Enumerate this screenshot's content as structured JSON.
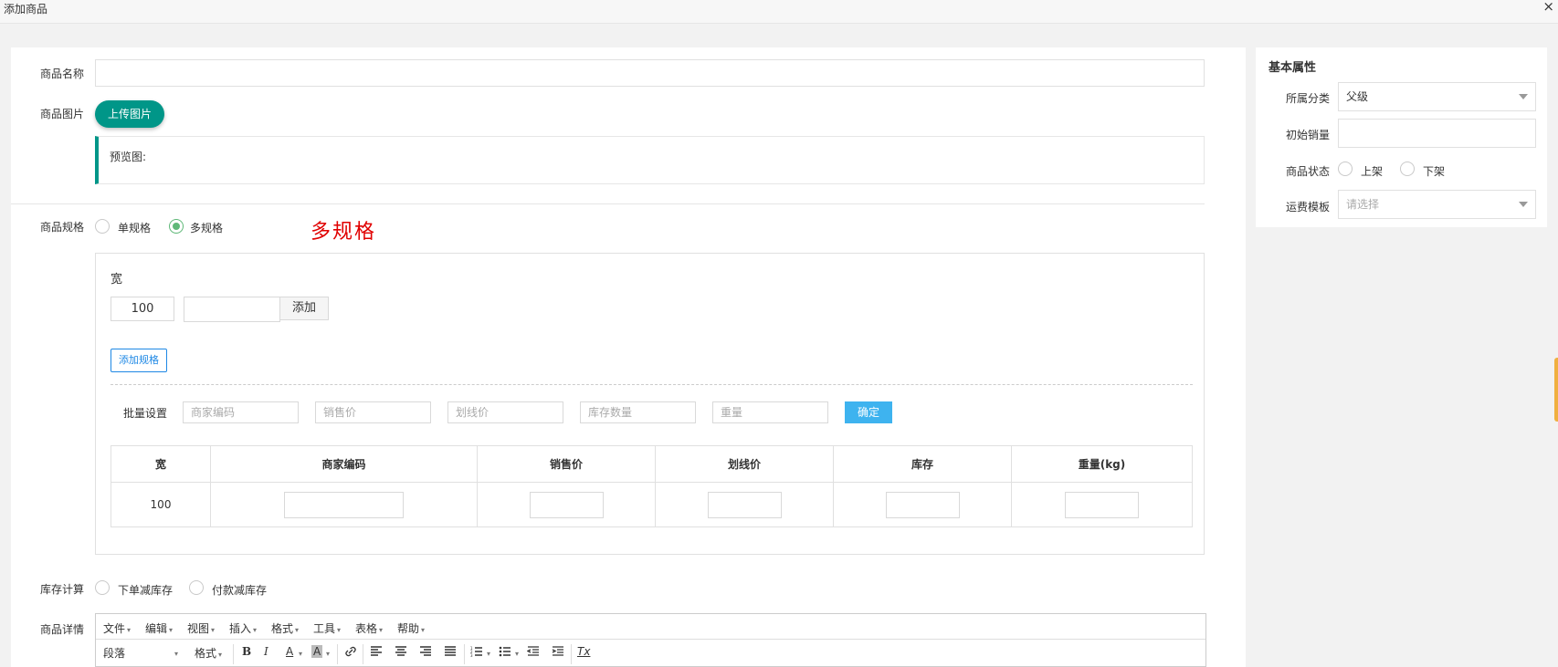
{
  "window": {
    "title": "添加商品",
    "close": "×"
  },
  "form": {
    "name_label": "商品名称",
    "image_label": "商品图片",
    "upload_button": "上传图片",
    "preview_label": "预览图:",
    "spec_label": "商品规格",
    "spec_options": [
      {
        "label": "单规格",
        "checked": false
      },
      {
        "label": "多规格",
        "checked": true
      }
    ],
    "red_annotation": "多规格",
    "spec_group": {
      "name": "宽",
      "values": [
        "100"
      ],
      "new_value": "",
      "add_value_button": "添加",
      "add_spec_button": "添加规格"
    },
    "batch": {
      "label": "批量设置",
      "placeholders": [
        "商家编码",
        "销售价",
        "划线价",
        "库存数量",
        "重量"
      ],
      "confirm": "确定"
    },
    "sku_table": {
      "headers": [
        "宽",
        "商家编码",
        "销售价",
        "划线价",
        "库存",
        "重量(kg)"
      ],
      "rows": [
        {
          "spec": "100"
        }
      ]
    },
    "stock_label": "库存计算",
    "stock_options": [
      {
        "label": "下单减库存",
        "checked": false
      },
      {
        "label": "付款减库存",
        "checked": false
      }
    ],
    "detail_label": "商品详情",
    "editor": {
      "menus": [
        "文件",
        "编辑",
        "视图",
        "插入",
        "格式",
        "工具",
        "表格",
        "帮助"
      ],
      "paragraph": "段落",
      "format": "格式",
      "tools": {
        "bold": "B",
        "italic": "I",
        "font_color": "A",
        "bg_color": "A",
        "link": "🔗",
        "clear": "Tx"
      }
    }
  },
  "side": {
    "title": "基本属性",
    "category_label": "所属分类",
    "category_value": "父级",
    "initial_sales_label": "初始销量",
    "initial_sales_value": "",
    "status_label": "商品状态",
    "status_options": [
      {
        "label": "上架",
        "checked": false
      },
      {
        "label": "下架",
        "checked": false
      }
    ],
    "shipping_label": "运费模板",
    "shipping_placeholder": "请选择"
  },
  "colors": {
    "primary": "#009688",
    "radio_checked": "#5fb878",
    "confirm": "#3eb3ef",
    "annotation": "#e00000",
    "link_blue": "#1e88e5"
  }
}
